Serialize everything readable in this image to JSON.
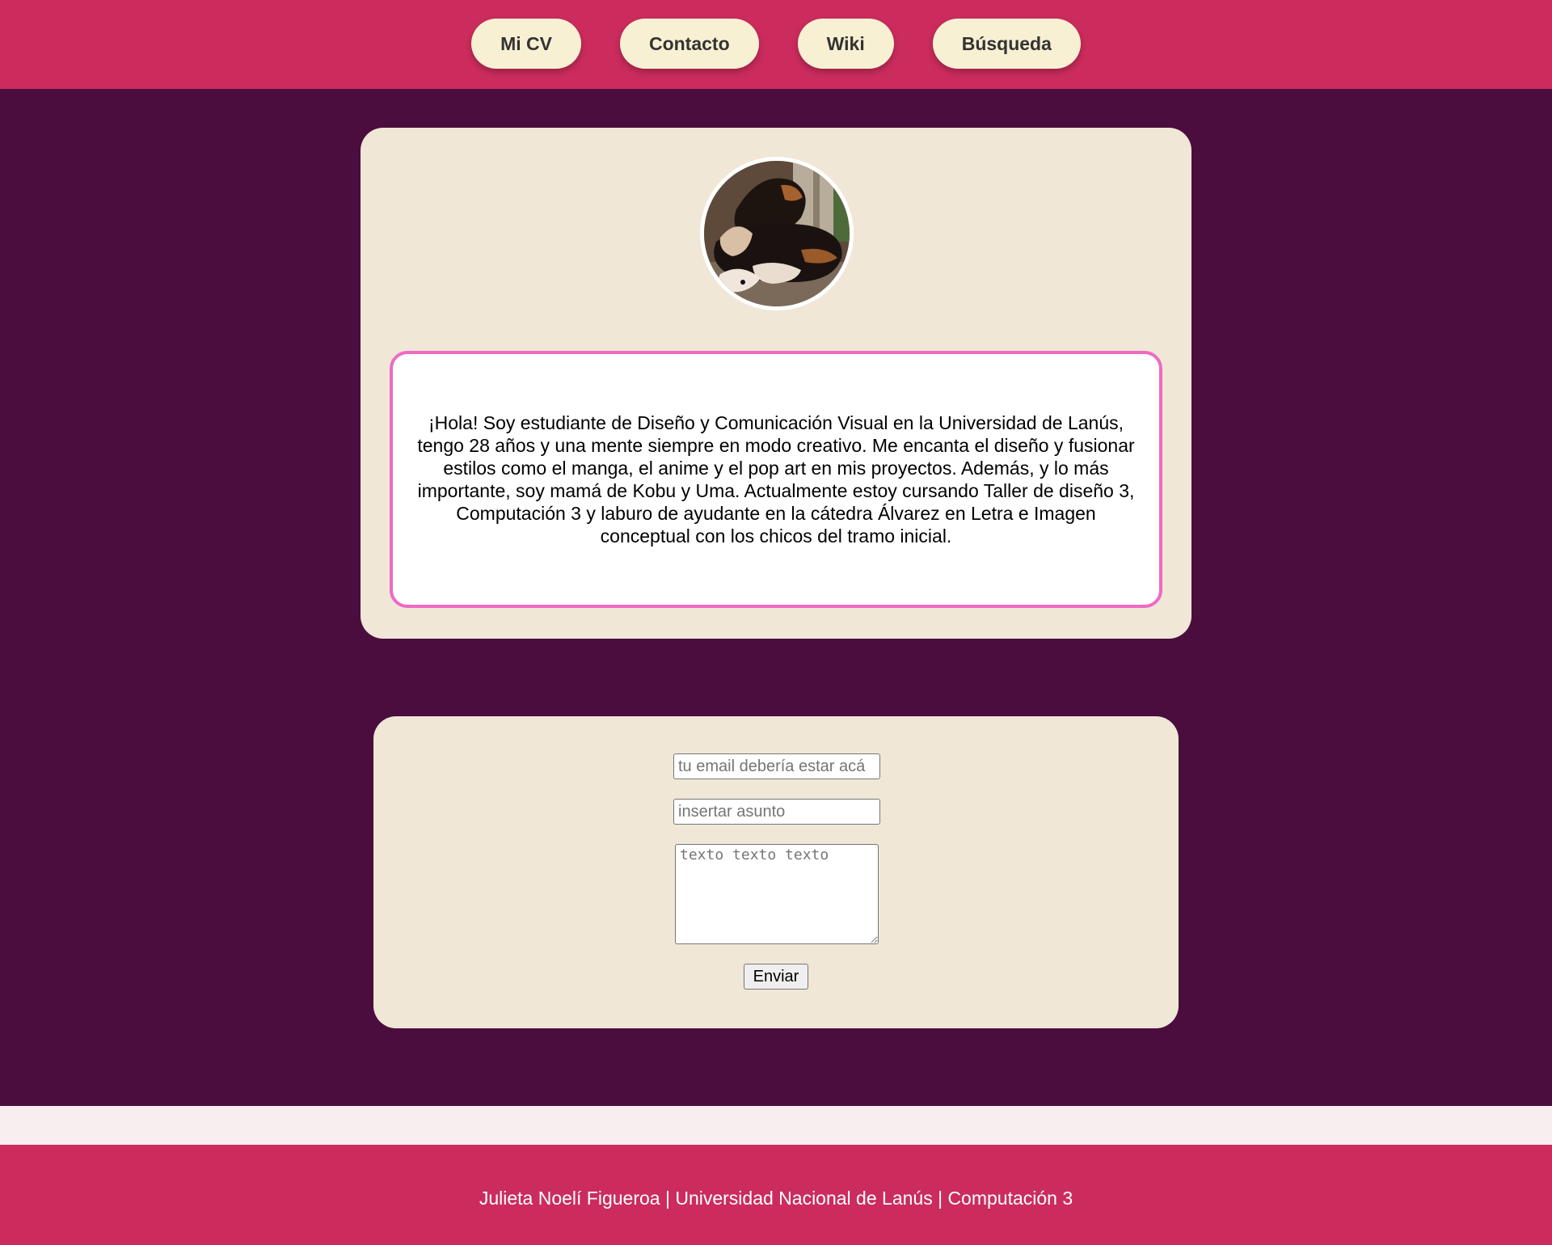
{
  "colors": {
    "header_bg": "#cb2c5d",
    "page_bg": "#4b0d3e",
    "card_bg": "#f0e7d7",
    "nav_button_bg": "#f8f0d3",
    "bio_border": "#ee6ac4",
    "footer_bg": "#cb2c5d",
    "strip_bg": "#f8eeef"
  },
  "nav": {
    "items": [
      {
        "label": "Mi CV"
      },
      {
        "label": "Contacto"
      },
      {
        "label": "Wiki"
      },
      {
        "label": "Búsqueda"
      }
    ]
  },
  "profile": {
    "avatar_icon": "dog-photo",
    "bio": "¡Hola! Soy estudiante de Diseño y Comunicación Visual en la Universidad de Lanús, tengo 28 años y una mente siempre en modo creativo. Me encanta el diseño y fusionar estilos como el manga, el anime y el pop art en mis proyectos. Además, y lo más importante, soy mamá de Kobu y Uma. Actualmente estoy cursando Taller de diseño 3, Computación 3 y laburo de ayudante en la cátedra Álvarez en Letra e Imagen conceptual con los chicos del tramo inicial."
  },
  "contact_form": {
    "email_placeholder": "tu email debería estar acá",
    "subject_placeholder": "insertar asunto",
    "message_placeholder": "texto texto texto",
    "submit_label": "Enviar"
  },
  "footer": {
    "text": "Julieta Noelí Figueroa | Universidad Nacional de Lanús | Computación 3"
  }
}
